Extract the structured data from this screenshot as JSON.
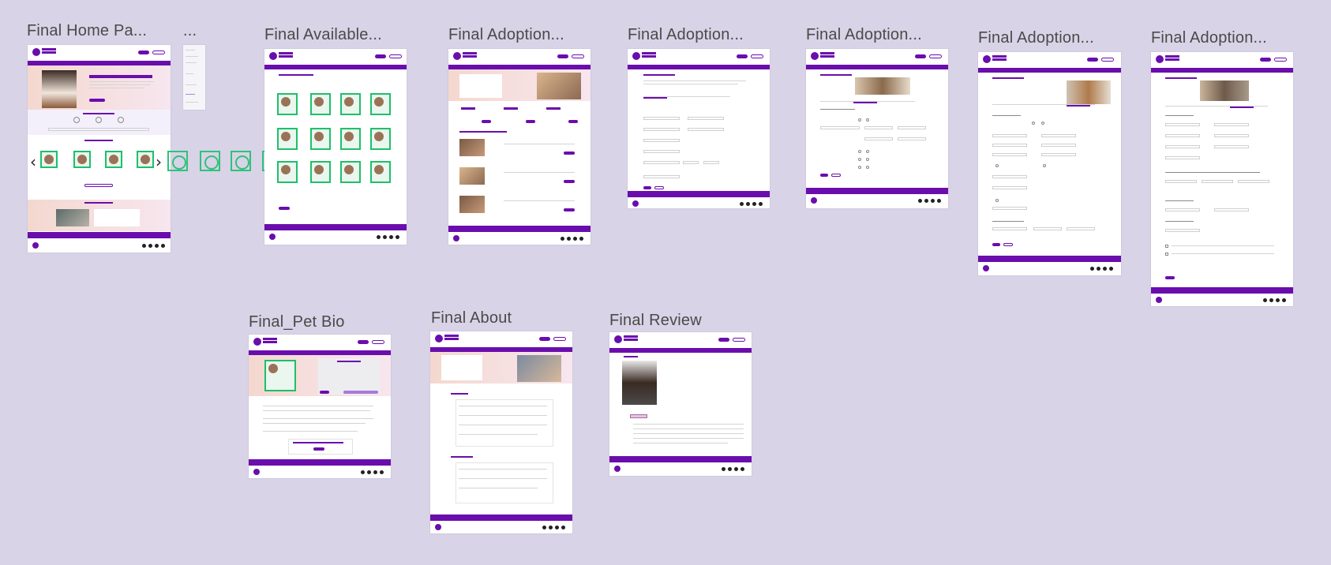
{
  "canvas": {
    "background": "#d8d3e6",
    "accent": "#6a0dad",
    "selection_color": "#1fbf6a"
  },
  "frames": [
    {
      "id": "home",
      "label": "Final Home Pa..."
    },
    {
      "id": "ellipsis",
      "label": "..."
    },
    {
      "id": "available",
      "label": "Final Available..."
    },
    {
      "id": "adoption1",
      "label": "Final Adoption..."
    },
    {
      "id": "adoption2",
      "label": "Final Adoption..."
    },
    {
      "id": "adoption3",
      "label": "Final Adoption..."
    },
    {
      "id": "adoption4",
      "label": "Final Adoption..."
    },
    {
      "id": "adoption5",
      "label": "Final Adoption..."
    },
    {
      "id": "petbio",
      "label": "Final_Pet Bio"
    },
    {
      "id": "about",
      "label": "Final About"
    },
    {
      "id": "review",
      "label": "Final Review"
    }
  ],
  "icons": {
    "prev": "‹",
    "next": "›"
  }
}
